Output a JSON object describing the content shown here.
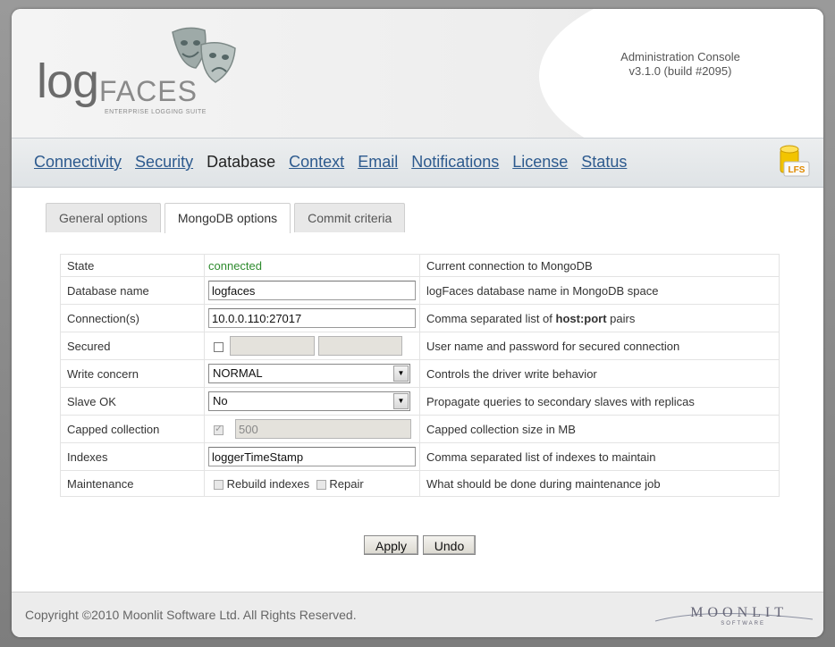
{
  "header": {
    "brand_log": "log",
    "brand_faces": "FACES",
    "brand_sub": "ENTERPRISE LOGGING SUITE",
    "console_title": "Administration Console",
    "version": "v3.1.0 (build #2095)"
  },
  "nav": {
    "items": [
      {
        "label": "Connectivity",
        "active": false
      },
      {
        "label": "Security",
        "active": false
      },
      {
        "label": "Database",
        "active": true
      },
      {
        "label": "Context",
        "active": false
      },
      {
        "label": "Email",
        "active": false
      },
      {
        "label": "Notifications",
        "active": false
      },
      {
        "label": "License",
        "active": false
      },
      {
        "label": "Status",
        "active": false
      }
    ],
    "icon_label": "LFS"
  },
  "tabs": [
    {
      "label": "General options",
      "active": false
    },
    {
      "label": "MongoDB options",
      "active": true
    },
    {
      "label": "Commit criteria",
      "active": false
    }
  ],
  "form": {
    "state": {
      "label": "State",
      "value": "connected",
      "desc": "Current connection to MongoDB"
    },
    "db_name": {
      "label": "Database name",
      "value": "logfaces",
      "desc": "logFaces database name in MongoDB space"
    },
    "connections": {
      "label": "Connection(s)",
      "value": "10.0.0.110:27017",
      "desc_pre": "Comma separated list of ",
      "desc_bold": "host:port",
      "desc_post": " pairs"
    },
    "secured": {
      "label": "Secured",
      "checked": false,
      "desc": "User name and password for secured connection"
    },
    "write_concern": {
      "label": "Write concern",
      "value": "NORMAL",
      "desc": "Controls the driver write behavior"
    },
    "slave_ok": {
      "label": "Slave OK",
      "value": "No",
      "desc": "Propagate queries to secondary slaves with replicas"
    },
    "capped": {
      "label": "Capped collection",
      "checked": true,
      "value": "500",
      "desc": "Capped collection size in MB"
    },
    "indexes": {
      "label": "Indexes",
      "value": "loggerTimeStamp",
      "desc": "Comma separated list of indexes to maintain"
    },
    "maintenance": {
      "label": "Maintenance",
      "opt1": "Rebuild indexes",
      "opt2": "Repair",
      "desc": "What should be done during maintenance job"
    }
  },
  "buttons": {
    "apply": "Apply",
    "undo": "Undo"
  },
  "footer": {
    "copyright": "Copyright ©2010 Moonlit Software Ltd. All Rights Reserved.",
    "logo_name": "MOONLIT",
    "logo_sub": "SOFTWARE"
  },
  "colors": {
    "link": "#2d5a8e",
    "connected": "#2e8b2e"
  }
}
